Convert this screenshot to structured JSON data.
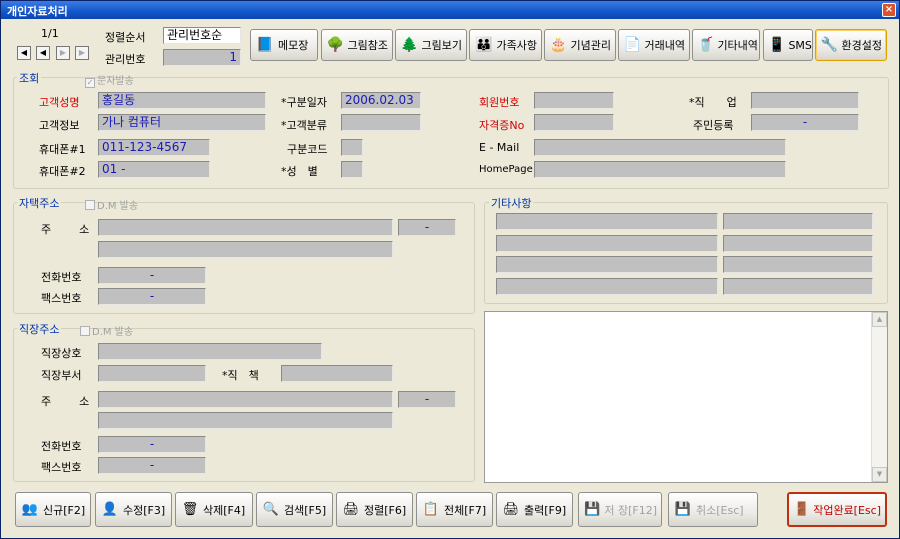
{
  "window": {
    "title": "개인자료처리",
    "close": "×"
  },
  "nav": {
    "record": "1/1",
    "first": "◀",
    "prev": "◀",
    "next": "▶",
    "last": "▶"
  },
  "sort": {
    "label": "정렬순서",
    "value": "관리번호순",
    "id_label": "관리번호",
    "id_value": "1"
  },
  "toolbar": [
    {
      "label": "메모장",
      "icon": "memo-icon",
      "glyph": "📘"
    },
    {
      "label": "그림참조",
      "icon": "tree-icon",
      "glyph": "🌳"
    },
    {
      "label": "그림보기",
      "icon": "tree-view-icon",
      "glyph": "🌲"
    },
    {
      "label": "가족사항",
      "icon": "family-icon",
      "glyph": "👪"
    },
    {
      "label": "기념관리",
      "icon": "cake-icon",
      "glyph": "🎂"
    },
    {
      "label": "거래내역",
      "icon": "document-icon",
      "glyph": "📄"
    },
    {
      "label": "기타내역",
      "icon": "cup-icon",
      "glyph": "🥤"
    },
    {
      "label": "SMS",
      "icon": "sms-icon",
      "glyph": "📱"
    },
    {
      "label": "환경설정",
      "icon": "tools-icon",
      "glyph": "🔧"
    }
  ],
  "lookup": {
    "title": "조회",
    "sms_check": "문자발송",
    "name_label": "고객성명",
    "name_value": "홍길동",
    "info_label": "고객정보",
    "info_value": "가나 컴퓨터",
    "phone1_label": "휴대폰#1",
    "phone1_value": "011-123-4567",
    "phone2_label": "휴대폰#2",
    "phone2_value": "01 -",
    "date_label": "*구분일자",
    "date_value": "2006.02.03",
    "class_label": "*고객분류",
    "class_value": "",
    "code_label": "구분코드",
    "code_value": "",
    "gender_label": "*성　별",
    "gender_value": "",
    "member_label": "회원번호",
    "member_value": "",
    "cert_label": "자격증No",
    "cert_value": "",
    "email_label": "E - Mail",
    "email_value": "",
    "homepage_label": "HomePage",
    "homepage_value": "",
    "job_label": "*직　　업",
    "job_value": "",
    "resident_label": "주민등록",
    "resident_value": "-"
  },
  "home": {
    "title": "자택주소",
    "dm": "D.M 발송",
    "addr_label": "주　　소",
    "zip_value": "-",
    "tel_label": "전화번호",
    "tel_value": "-",
    "fax_label": "팩스번호",
    "fax_value": "-"
  },
  "etc": {
    "title": "기타사항"
  },
  "work": {
    "title": "직장주소",
    "dm": "D.M 발송",
    "company_label": "직장상호",
    "dept_label": "직장부서",
    "position_label": "*직　책",
    "addr_label": "주　　소",
    "zip_value": "-",
    "tel_label": "전화번호",
    "tel_value": "-",
    "fax_label": "팩스번호",
    "fax_value": "-"
  },
  "bottom": [
    {
      "label": "신규[F2]",
      "icon": "new-user-icon",
      "glyph": "👥"
    },
    {
      "label": "수정[F3]",
      "icon": "edit-user-icon",
      "glyph": "👤"
    },
    {
      "label": "삭제[F4]",
      "icon": "delete-user-icon",
      "glyph": "🗑"
    },
    {
      "label": "검색[F5]",
      "icon": "search-user-icon",
      "glyph": "🔍"
    },
    {
      "label": "정렬[F6]",
      "icon": "sort-icon",
      "glyph": "🖨"
    },
    {
      "label": "전체[F7]",
      "icon": "list-icon",
      "glyph": "📋"
    },
    {
      "label": "출력[F9]",
      "icon": "print-icon",
      "glyph": "🖨"
    },
    {
      "label": "저 장[F12]",
      "icon": "save-icon",
      "glyph": "💾"
    },
    {
      "label": "취소[Esc]",
      "icon": "cancel-icon",
      "glyph": "💾"
    },
    {
      "label": "작업완료[Esc]",
      "icon": "exit-door-icon",
      "glyph": "🚪"
    }
  ],
  "colors": {
    "titlebar": "#1257c9",
    "panel": "#ece9d8",
    "field": "#c0c0c0",
    "required": "#d20000",
    "value": "#1a1ab4"
  }
}
